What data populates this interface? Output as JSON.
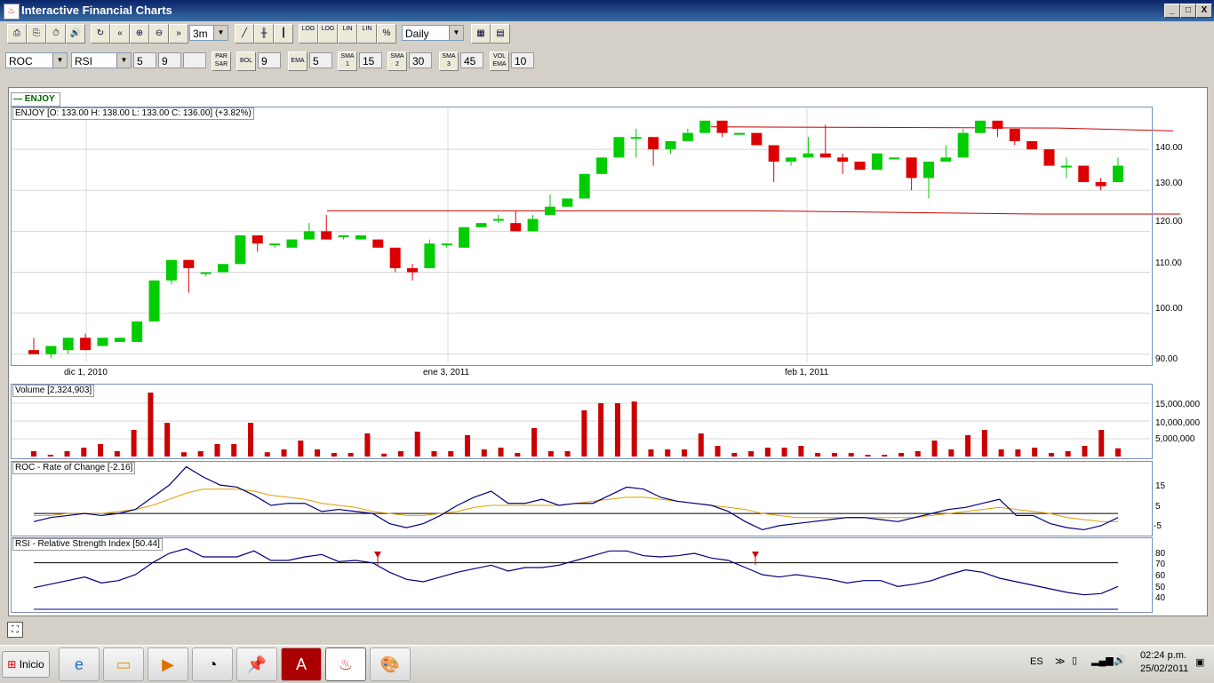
{
  "window": {
    "title": "Interactive Financial Charts",
    "controls": [
      "_",
      "□",
      "X"
    ]
  },
  "toolbar1": {
    "buttons": [
      "⎙",
      "⎘",
      "⏱",
      "🔊",
      "↻",
      "«",
      "⊕",
      "⊖",
      "»"
    ],
    "period": "3m",
    "chart_buttons": [
      "╱",
      "╫",
      "┃"
    ],
    "scale_buttons": [
      "LOG",
      "LOG",
      "LIN",
      "LIN",
      "%"
    ],
    "interval": "Daily",
    "extra_buttons": [
      "▦",
      "▤"
    ]
  },
  "toolbar2": {
    "indicator1": "ROC",
    "indicator2": "RSI",
    "val1": "5",
    "val2": "9",
    "val3": "",
    "par_sar": "PAR SAR",
    "bol": "BOL",
    "bol_val": "9",
    "ema": "EMA",
    "ema_val": "5",
    "sma1": "SMA 1",
    "sma1_val": "15",
    "sma2": "SMA 2",
    "sma2_val": "30",
    "sma3": "SMA 3",
    "sma3_val": "45",
    "vol_ema": "VOL EMA",
    "vol_ema_val": "10"
  },
  "legend": "ENJOY",
  "price_panel": {
    "label": "ENJOY [O: 133.00  H: 138.00  L: 133.00  C: 136.00] (+3.82%)",
    "y_ticks": [
      "140.00",
      "130.00",
      "120.00",
      "110.00",
      "100.00",
      "90.00"
    ],
    "x_ticks": [
      "dic 1, 2010",
      "ene 3, 2011",
      "feb 1, 2011"
    ]
  },
  "volume_panel": {
    "label": "Volume [2,324,903]",
    "y_ticks": [
      "15,000,000",
      "10,000,000",
      "5,000,000"
    ]
  },
  "roc_panel": {
    "label": "ROC - Rate of Change [-2.16]",
    "y_ticks": [
      "15",
      "5",
      "-5"
    ]
  },
  "rsi_panel": {
    "label": "RSI - Relative Strength Index [50.44]",
    "y_ticks": [
      "80",
      "70",
      "60",
      "50",
      "40"
    ]
  },
  "chart_data": {
    "type": "candlestick",
    "ohlc": [
      [
        91,
        94,
        90,
        90
      ],
      [
        90,
        92,
        89,
        92
      ],
      [
        91,
        94,
        90,
        94
      ],
      [
        94,
        95,
        91,
        91
      ],
      [
        92,
        94,
        92,
        94
      ],
      [
        93,
        94,
        93,
        94
      ],
      [
        93,
        98,
        93,
        98
      ],
      [
        98,
        108,
        98,
        108
      ],
      [
        108,
        113,
        107,
        113
      ],
      [
        113,
        113,
        105,
        111
      ],
      [
        110,
        110,
        109,
        110
      ],
      [
        110,
        112,
        110,
        112
      ],
      [
        112,
        119,
        112,
        119
      ],
      [
        119,
        119,
        115,
        117
      ],
      [
        117,
        117,
        116,
        117
      ],
      [
        116,
        118,
        116,
        118
      ],
      [
        118,
        122,
        118,
        120
      ],
      [
        120,
        124,
        118,
        118
      ],
      [
        119,
        119,
        118,
        119
      ],
      [
        118,
        119,
        118,
        119
      ],
      [
        118,
        118,
        116,
        116
      ],
      [
        116,
        116,
        110,
        111
      ],
      [
        111,
        112,
        108,
        110
      ],
      [
        111,
        118,
        111,
        117
      ],
      [
        117,
        117,
        116,
        117
      ],
      [
        116,
        121,
        116,
        121
      ],
      [
        121,
        122,
        121,
        122
      ],
      [
        123,
        124,
        122,
        123
      ],
      [
        122,
        125,
        120,
        120
      ],
      [
        120,
        124,
        120,
        123
      ],
      [
        124,
        129,
        124,
        126
      ],
      [
        126,
        128,
        126,
        128
      ],
      [
        128,
        134,
        128,
        134
      ],
      [
        134,
        135,
        134,
        138
      ],
      [
        138,
        143,
        138,
        143
      ],
      [
        143,
        145,
        138,
        143
      ],
      [
        143,
        143,
        136,
        140
      ],
      [
        140,
        142,
        139,
        142
      ],
      [
        142,
        145,
        142,
        144
      ],
      [
        144,
        147,
        144,
        147
      ],
      [
        147,
        147,
        143,
        144
      ],
      [
        144,
        144,
        144,
        144
      ],
      [
        144,
        144,
        141,
        141
      ],
      [
        141,
        141,
        132,
        137
      ],
      [
        137,
        138,
        136,
        138
      ],
      [
        138,
        143,
        138,
        139
      ],
      [
        139,
        146,
        139,
        138
      ],
      [
        138,
        139,
        134,
        137
      ],
      [
        137,
        137,
        135,
        135
      ],
      [
        135,
        139,
        135,
        139
      ],
      [
        138,
        138,
        138,
        138
      ],
      [
        138,
        138,
        130,
        133
      ],
      [
        133,
        137,
        128,
        137
      ],
      [
        137,
        141,
        137,
        138
      ],
      [
        138,
        145,
        138,
        144
      ],
      [
        144,
        147,
        144,
        147
      ],
      [
        147,
        147,
        143,
        145
      ],
      [
        145,
        145,
        141,
        142
      ],
      [
        142,
        142,
        140,
        140
      ],
      [
        140,
        140,
        136,
        136
      ],
      [
        136,
        138,
        133,
        136
      ],
      [
        136,
        136,
        132,
        132
      ],
      [
        132,
        133,
        130,
        131
      ],
      [
        132,
        138,
        132,
        136
      ]
    ],
    "volume_millions": [
      1.5,
      0.5,
      1.5,
      2.5,
      3.5,
      1.5,
      7.5,
      18,
      9.5,
      1.2,
      1.5,
      3.5,
      3.5,
      9.5,
      1.2,
      2.0,
      4.5,
      2.0,
      1.0,
      1.0,
      6.5,
      0.8,
      1.5,
      7.0,
      1.5,
      1.5,
      6.0,
      2.0,
      2.5,
      1.0,
      8.0,
      1.5,
      1.5,
      13,
      15,
      15,
      15.5,
      2.0,
      2.0,
      2.0,
      6.5,
      3.0,
      1.0,
      1.5,
      2.5,
      2.5,
      3.0,
      1.0,
      1.0,
      1.0,
      0.5,
      0.5,
      1.0,
      1.5,
      4.5,
      2.0,
      6.0,
      7.5,
      2.0,
      2.0,
      2.5,
      1.0,
      1.5,
      3.0,
      7.5,
      2.3
    ],
    "roc": [
      -4,
      -2,
      -1,
      0,
      -1,
      0,
      2,
      8,
      14,
      23,
      18,
      14,
      13,
      9,
      4,
      5,
      5,
      1,
      2,
      1,
      0,
      -5,
      -7,
      -5,
      -1,
      4,
      8,
      11,
      5,
      5,
      7,
      4,
      5,
      5,
      9,
      13,
      12,
      8,
      6,
      5,
      4,
      1,
      -4,
      -8,
      -6,
      -5,
      -4,
      -3,
      -2,
      -2,
      -3,
      -4,
      -2,
      0,
      2,
      3,
      5,
      7,
      -1,
      -1,
      -5,
      -7,
      -8,
      -6,
      -2
    ],
    "rsi": [
      49,
      52,
      55,
      58,
      53,
      55,
      60,
      70,
      78,
      82,
      75,
      75,
      75,
      80,
      72,
      72,
      75,
      77,
      71,
      72,
      70,
      62,
      56,
      54,
      58,
      62,
      65,
      68,
      63,
      66,
      66,
      68,
      72,
      76,
      80,
      80,
      76,
      75,
      76,
      78,
      74,
      72,
      66,
      60,
      58,
      60,
      58,
      56,
      53,
      55,
      55,
      50,
      52,
      55,
      60,
      64,
      62,
      57,
      54,
      51,
      48,
      45,
      43,
      44,
      50
    ],
    "roc_signal": [
      -1,
      -1,
      0,
      0,
      0,
      1,
      2,
      4,
      7,
      10,
      12,
      12,
      12,
      11,
      9,
      8,
      7,
      5,
      4,
      3,
      1,
      0,
      -1,
      -1,
      0,
      1,
      3,
      4,
      4,
      4,
      4,
      4,
      5,
      6,
      7,
      8,
      8,
      7,
      6,
      5,
      4,
      3,
      2,
      0,
      -1,
      -2,
      -2,
      -2,
      -2,
      -2,
      -2,
      -2,
      -2,
      -1,
      0,
      1,
      2,
      3,
      2,
      1,
      0,
      -2,
      -3,
      -4,
      -4
    ],
    "resistance": 145,
    "support_levels": [
      125,
      124
    ],
    "price_ylim": [
      88,
      150
    ],
    "volume_ylim": [
      0,
      20
    ],
    "roc_ylim": [
      -10,
      25
    ],
    "rsi_ylim": [
      30,
      90
    ],
    "rsi_level": 70
  },
  "taskbar": {
    "start": "Inicio",
    "lang": "ES",
    "time": "02:24 p.m.",
    "date": "25/02/2011"
  },
  "colors": {
    "up": "#00cc00",
    "down": "#dd0000",
    "line": "#000080",
    "signal": "#e0a000",
    "grid": "#d8d8d8"
  }
}
